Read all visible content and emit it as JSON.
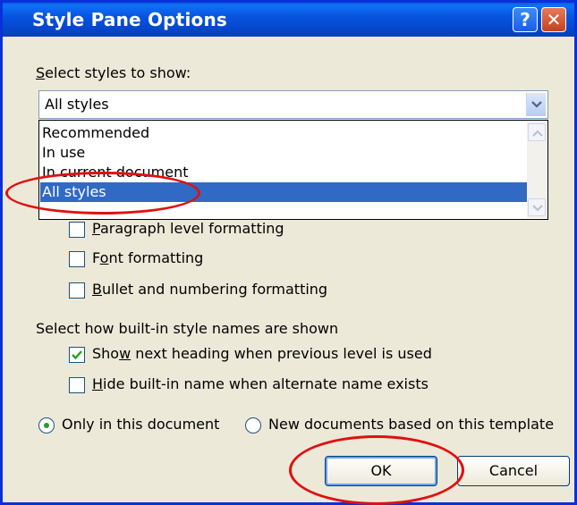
{
  "dialog": {
    "title": "Style Pane Options",
    "help_glyph": "?",
    "close_glyph": "✕"
  },
  "select_styles": {
    "label_prefix": "",
    "label_ul": "S",
    "label_rest": "elect styles to show:",
    "value": "All styles",
    "options": [
      "Recommended",
      "In use",
      "In current document",
      "All styles"
    ],
    "selected_index": 3
  },
  "formatting": {
    "paragraph_ul": "P",
    "paragraph_rest": "aragraph level formatting",
    "font_pre": "F",
    "font_ul": "o",
    "font_rest": "nt formatting",
    "bullet_ul": "B",
    "bullet_rest": "ullet and numbering formatting"
  },
  "names": {
    "heading": "Select how built-in style names are shown",
    "show_next_pre": "Sho",
    "show_next_ul": "w",
    "show_next_rest": " next heading when previous level is used",
    "show_next_checked": true,
    "hide_builtin_ul": "H",
    "hide_builtin_rest": "ide built-in name when alternate name exists",
    "hide_builtin_checked": false
  },
  "scope": {
    "only_doc": "Only in this document",
    "new_docs": "New documents based on this template",
    "selected": "only_doc"
  },
  "buttons": {
    "ok": "OK",
    "cancel": "Cancel"
  },
  "colors": {
    "highlight": "#316ac5",
    "annotation": "#e01010",
    "titlebar": "#0854df"
  }
}
